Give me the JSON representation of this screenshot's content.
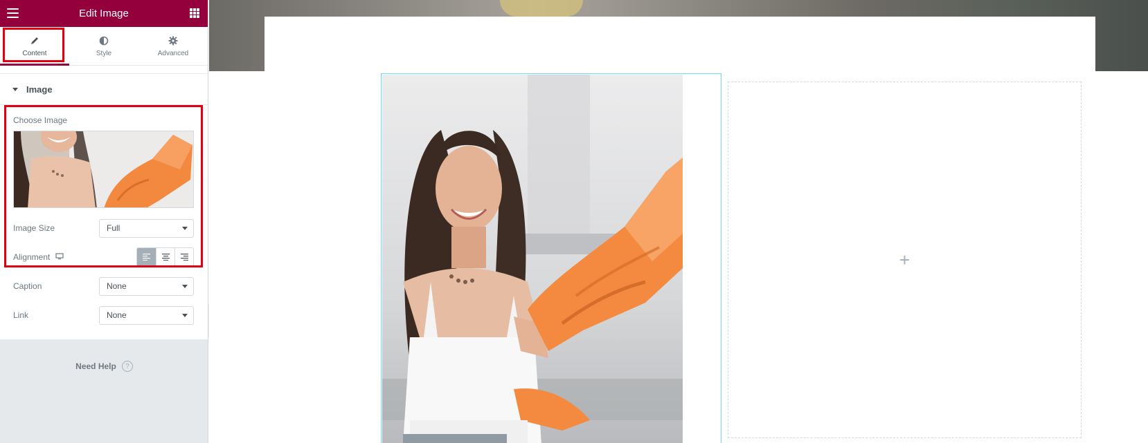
{
  "header": {
    "title": "Edit Image"
  },
  "tabs": [
    {
      "label": "Content",
      "icon": "pencil-icon",
      "active": true
    },
    {
      "label": "Style",
      "icon": "half-circle-icon",
      "active": false
    },
    {
      "label": "Advanced",
      "icon": "gear-icon",
      "active": false
    }
  ],
  "section": {
    "title": "Image"
  },
  "controls": {
    "choose_image_label": "Choose Image",
    "image_size_label": "Image Size",
    "image_size_value": "Full",
    "alignment_label": "Alignment",
    "caption_label": "Caption",
    "caption_value": "None",
    "link_label": "Link",
    "link_value": "None"
  },
  "help": {
    "label": "Need Help",
    "icon_text": "?"
  },
  "collapse": {
    "glyph": "‹"
  },
  "preview": {
    "add_glyph": "+"
  },
  "colors": {
    "brand": "#93003c",
    "highlight": "#e1000f",
    "selected_border": "#71d7f7"
  }
}
